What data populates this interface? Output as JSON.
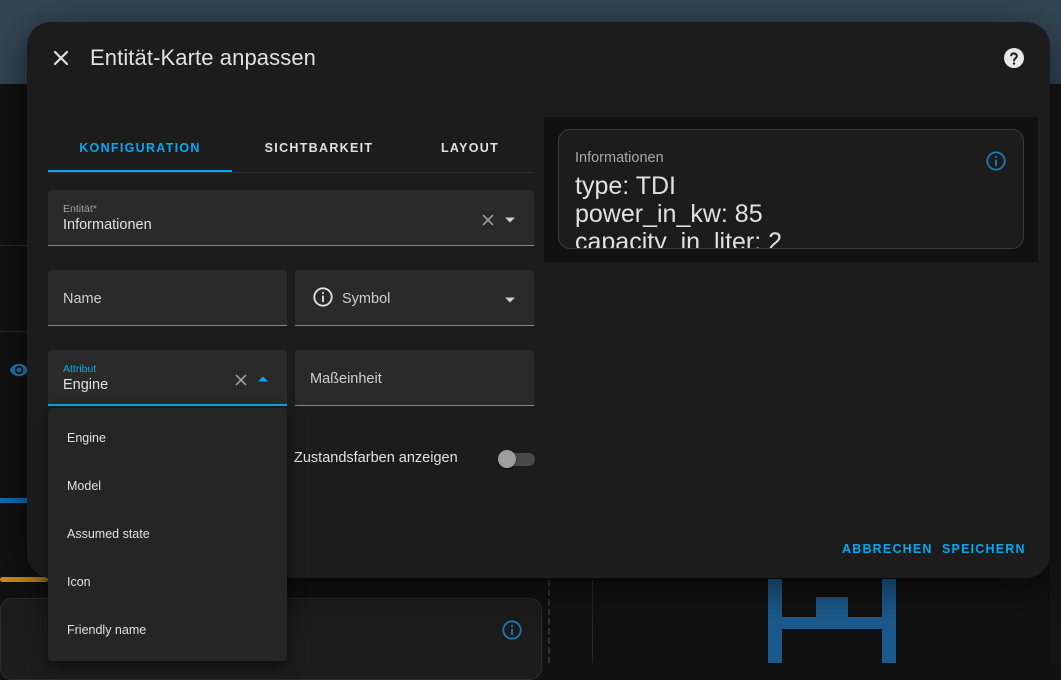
{
  "dialog": {
    "title": "Entität-Karte anpassen",
    "close_icon": "close-icon",
    "help_icon": "help-circle-icon"
  },
  "tabs": [
    {
      "label": "KONFIGURATION",
      "active": true
    },
    {
      "label": "SICHTBARKEIT",
      "active": false
    },
    {
      "label": "LAYOUT",
      "active": false
    }
  ],
  "form": {
    "entity": {
      "label": "Entität*",
      "value": "Informationen"
    },
    "name": {
      "placeholder": "Name"
    },
    "symbol": {
      "placeholder": "Symbol",
      "icon": "information-outline-icon"
    },
    "attribute": {
      "label": "Attribut",
      "value": "Engine"
    },
    "unit": {
      "placeholder": "Maßeinheit"
    },
    "state_color": {
      "label": "Zustandsfarben anzeigen",
      "checked": false
    }
  },
  "dropdown": {
    "options": [
      "Engine",
      "Model",
      "Assumed state",
      "Icon",
      "Friendly name"
    ]
  },
  "actions": {
    "cancel": "ABBRECHEN",
    "save": "SPEICHERN"
  },
  "preview": {
    "title": "Informationen",
    "lines": [
      "type: TDI",
      "power_in_kw: 85",
      "capacity_in_liter: 2"
    ]
  },
  "colors": {
    "accent": "#03a9f4",
    "surface": "#1c1c1c",
    "field": "#2a2a2a",
    "background_header": "#334553"
  }
}
